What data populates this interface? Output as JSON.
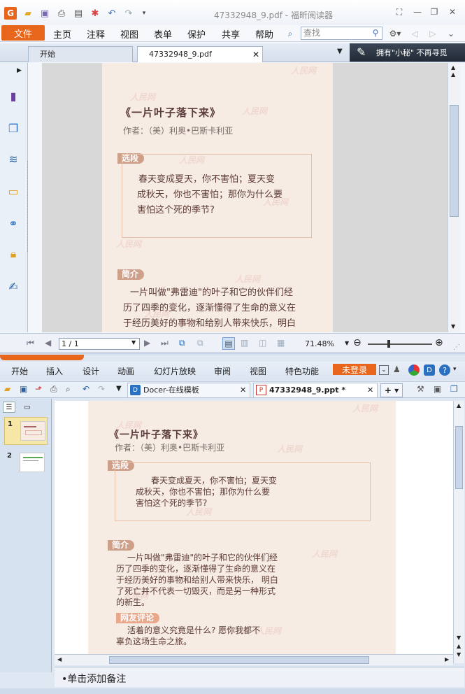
{
  "foxit": {
    "window_title": "47332948_9.pdf - 福昕阅读器",
    "file_label": "文件",
    "menu": [
      "主页",
      "注释",
      "视图",
      "表单",
      "保护",
      "共享",
      "帮助"
    ],
    "search_placeholder": "查找",
    "tabs": [
      "开始",
      "47332948_9.pdf"
    ],
    "promo_text": "拥有\"小秘\" 不再寻觅",
    "page_input": "1 / 1",
    "zoom": "71.48%"
  },
  "doc": {
    "title": "《一片叶子落下来》",
    "author": "作者：（美）利奥•巴斯卡利亚",
    "excerpt_tag": "选段",
    "excerpt_lines": [
      "春天变成夏天，你不害怕；夏天变",
      "成秋天，你也不害怕；那你为什么要",
      "害怕这个死的季节?"
    ],
    "intro_tag": "简介",
    "intro_lines_pdf": [
      "一片叫做\"弗雷迪\"的叶子和它的伙伴们经",
      "历了四季的变化，逐渐懂得了生命的意义在",
      "于经历美好的事物和给别人带来快乐，明白"
    ],
    "intro_lines_ppt": [
      "一片叫做\"弗雷迪\"的叶子和它的伙伴们经",
      "历了四季的变化，逐渐懂得了生命的意义在",
      "于经历美好的事物和给别人带来快乐，  明白",
      "了死亡并不代表一切毁灭，而是另一种形式",
      "的新生。"
    ],
    "review_tag": "网友评论",
    "review_lines": [
      "活着的意义究竟是什么? 愿你我都不",
      "辜负这场生命之旅。"
    ],
    "watermark": "人民网"
  },
  "wps": {
    "menu": [
      "开始",
      "插入",
      "设计",
      "动画",
      "幻灯片放映",
      "审阅",
      "视图",
      "特色功能"
    ],
    "login_label": "未登录",
    "tabs": [
      "Docer-在线模板",
      "47332948_9.ppt *"
    ],
    "slide_numbers": [
      "1",
      "2"
    ],
    "notes_placeholder": "•单击添加备注"
  },
  "colors": {
    "accent_orange": "#e8661c",
    "page_bg": "#f7ece4",
    "tag_bg": "#cfa089"
  }
}
